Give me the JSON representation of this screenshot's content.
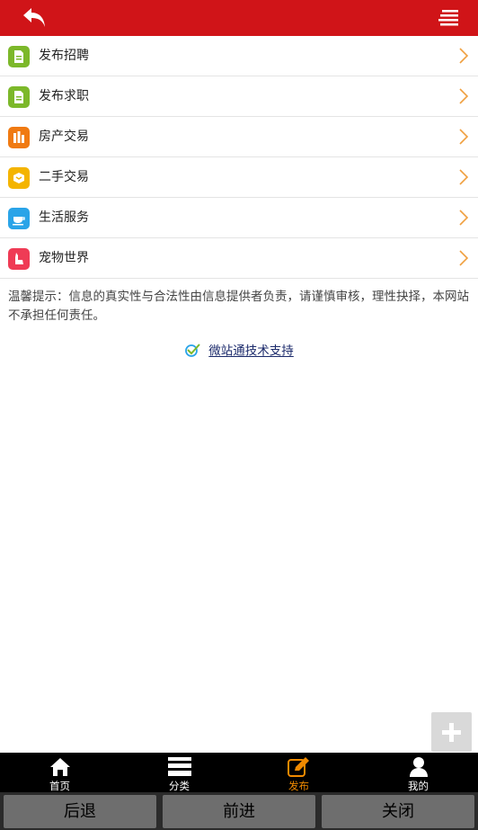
{
  "colors": {
    "header": "#d01418",
    "active_tab": "#f08a00"
  },
  "header": {
    "back_icon": "back-arrow-icon",
    "menu_icon": "menu-icon"
  },
  "menu": [
    {
      "label": "发布招聘",
      "icon": "document-icon",
      "color": "#7cb82a"
    },
    {
      "label": "发布求职",
      "icon": "document-icon",
      "color": "#7cb82a"
    },
    {
      "label": "房产交易",
      "icon": "building-icon",
      "color": "#f07a12"
    },
    {
      "label": "二手交易",
      "icon": "box-icon",
      "color": "#f4b400"
    },
    {
      "label": "生活服务",
      "icon": "cup-icon",
      "color": "#2aa4e8"
    },
    {
      "label": "宠物世界",
      "icon": "pet-icon",
      "color": "#ef3b55"
    }
  ],
  "tip": "温馨提示：信息的真实性与合法性由信息提供者负责，请谨慎审核，理性抉择，本网站不承担任何责任。",
  "support_link": "微站通技术支持",
  "tabs": [
    {
      "label": "首页",
      "icon": "home-icon"
    },
    {
      "label": "分类",
      "icon": "category-icon"
    },
    {
      "label": "发布",
      "icon": "edit-icon",
      "active": true
    },
    {
      "label": "我的",
      "icon": "user-icon"
    }
  ],
  "nav": {
    "back": "后退",
    "forward": "前进",
    "close": "关闭"
  }
}
